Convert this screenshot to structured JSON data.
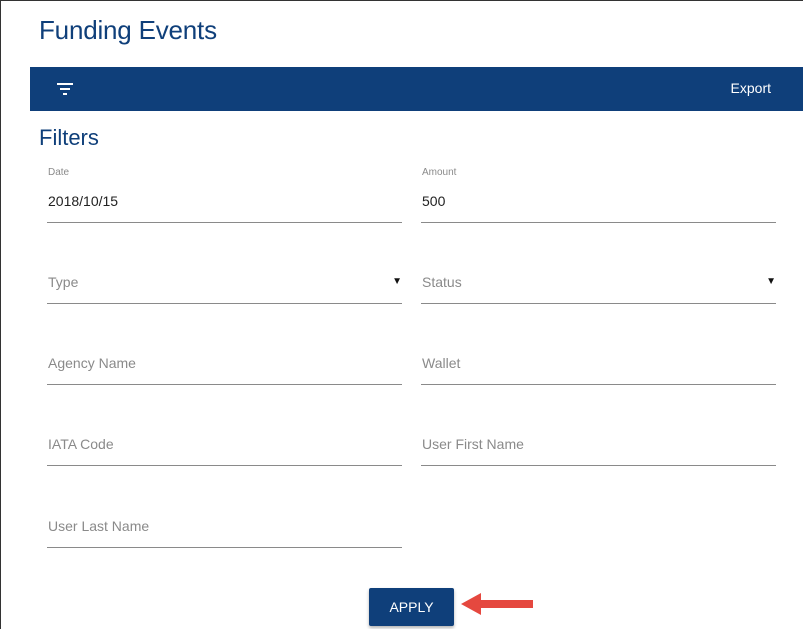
{
  "page": {
    "title": "Funding Events"
  },
  "toolbar": {
    "filter_icon": "filter-icon",
    "export_label": "Export",
    "bar_color": "#0f3f7a"
  },
  "filters": {
    "title": "Filters",
    "date": {
      "label": "Date",
      "value": "2018/10/15"
    },
    "amount": {
      "label": "Amount",
      "value": "500"
    },
    "type": {
      "placeholder": "Type"
    },
    "status": {
      "placeholder": "Status"
    },
    "agency_name": {
      "placeholder": "Agency Name"
    },
    "wallet": {
      "placeholder": "Wallet"
    },
    "iata_code": {
      "placeholder": "IATA Code"
    },
    "user_first_name": {
      "placeholder": "User First Name"
    },
    "user_last_name": {
      "placeholder": "User Last Name"
    },
    "apply_label": "APPLY"
  },
  "annotation": {
    "arrow_color": "#e5483f"
  }
}
